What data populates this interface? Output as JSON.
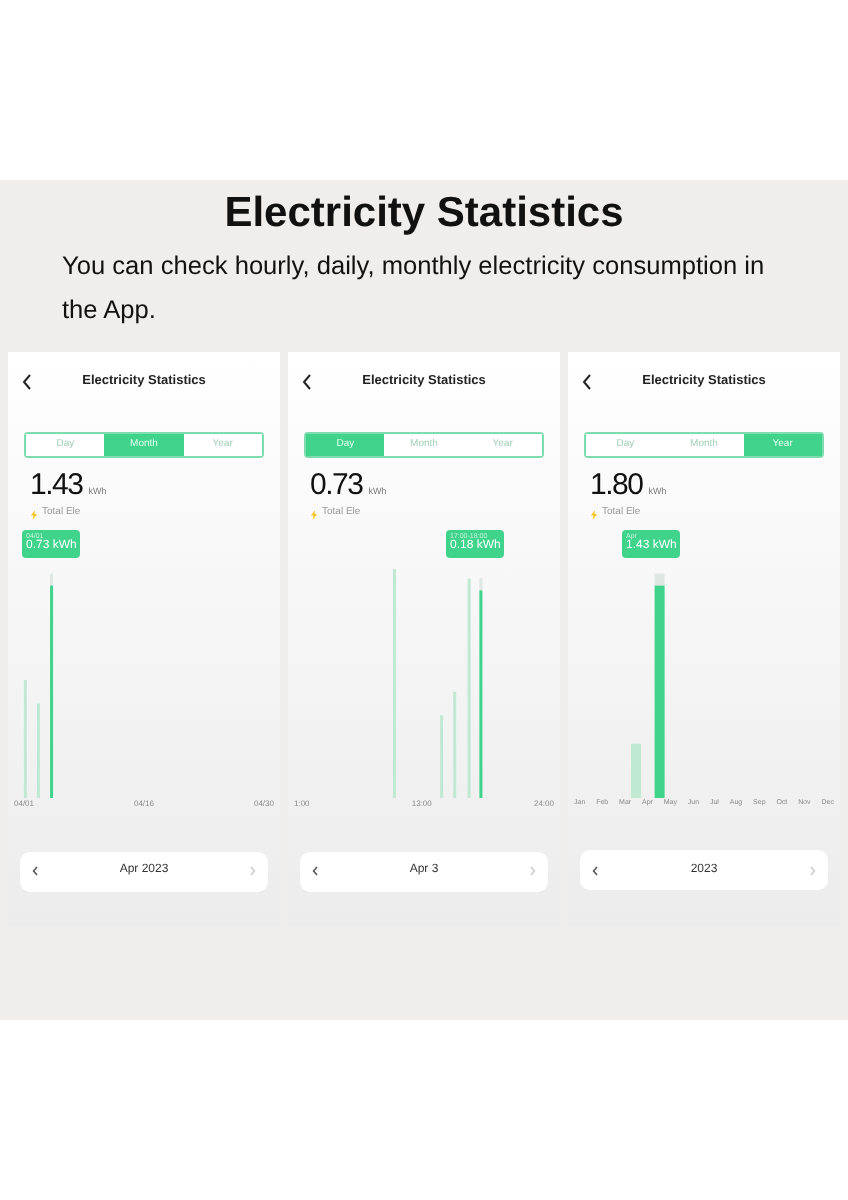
{
  "heading": "Electricity Statistics",
  "description": "You can check hourly, daily, monthly electricity consumption in the App.",
  "phones": [
    {
      "title": "Electricity Statistics",
      "tabs": [
        {
          "label": "Day",
          "selected": false
        },
        {
          "label": "Month",
          "selected": true
        },
        {
          "label": "Year",
          "selected": false
        }
      ],
      "total": "1.43",
      "unit": "kWh",
      "total_label": "Total Ele",
      "tooltip": {
        "label": "04/01",
        "value": "0.73 kWh"
      },
      "x_labels": [
        "04/01",
        "04/16",
        "04/30"
      ],
      "period": "Apr 2023"
    },
    {
      "title": "Electricity Statistics",
      "tabs": [
        {
          "label": "Day",
          "selected": true
        },
        {
          "label": "Month",
          "selected": false
        },
        {
          "label": "Year",
          "selected": false
        }
      ],
      "total": "0.73",
      "unit": "kWh",
      "total_label": "Total Ele",
      "tooltip": {
        "label": "17:00-18:00",
        "value": "0.18 kWh"
      },
      "x_labels": [
        "1:00",
        "13:00",
        "24:00"
      ],
      "period": "Apr 3"
    },
    {
      "title": "Electricity Statistics",
      "tabs": [
        {
          "label": "Day",
          "selected": false
        },
        {
          "label": "Month",
          "selected": false
        },
        {
          "label": "Year",
          "selected": true
        }
      ],
      "total": "1.80",
      "unit": "kWh",
      "total_label": "Total Ele",
      "tooltip": {
        "label": "Apr",
        "value": "1.43 kWh"
      },
      "x_labels": [
        "Jan",
        "Feb",
        "Mar",
        "Apr",
        "May",
        "Jun",
        "Jul",
        "Aug",
        "Sep",
        "Oct",
        "Nov",
        "Dec"
      ],
      "period": "2023"
    }
  ]
}
